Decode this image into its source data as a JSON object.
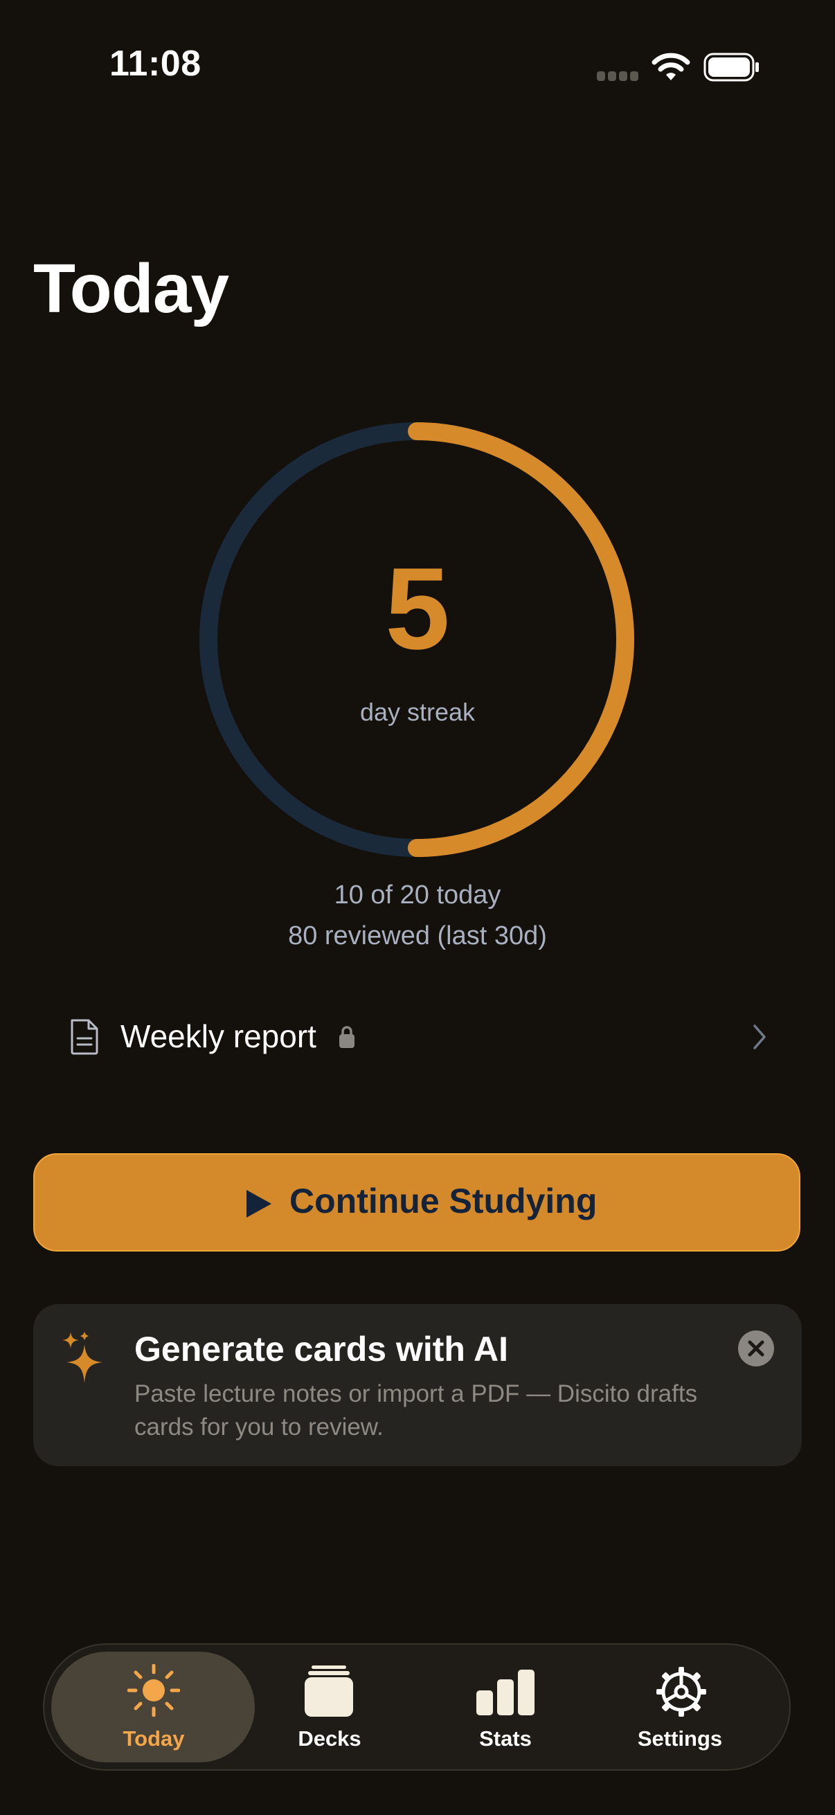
{
  "status_bar": {
    "time": "11:08"
  },
  "header": {
    "title": "Today"
  },
  "streak": {
    "number": "5",
    "label": "day streak",
    "progress": 0.5,
    "progress_color": "#d68a2a",
    "track_color": "#1a2a3b"
  },
  "summary": {
    "today": "10 of 20 today",
    "reviewed": "80 reviewed (last 30d)"
  },
  "weekly_report": {
    "label": "Weekly report",
    "locked": true
  },
  "continue_button": {
    "label": "Continue Studying"
  },
  "ai_card": {
    "title": "Generate cards with AI",
    "body": "Paste lecture notes or import a PDF — Discito drafts cards for you to review."
  },
  "tabs": [
    {
      "label": "Today",
      "icon": "sun-icon",
      "active": true
    },
    {
      "label": "Decks",
      "icon": "stack-icon",
      "active": false
    },
    {
      "label": "Stats",
      "icon": "bar-chart-icon",
      "active": false
    },
    {
      "label": "Settings",
      "icon": "gear-icon",
      "active": false
    }
  ],
  "colors": {
    "accent": "#d4892a",
    "background": "#14100b",
    "active_tab": "#f3a64a"
  }
}
